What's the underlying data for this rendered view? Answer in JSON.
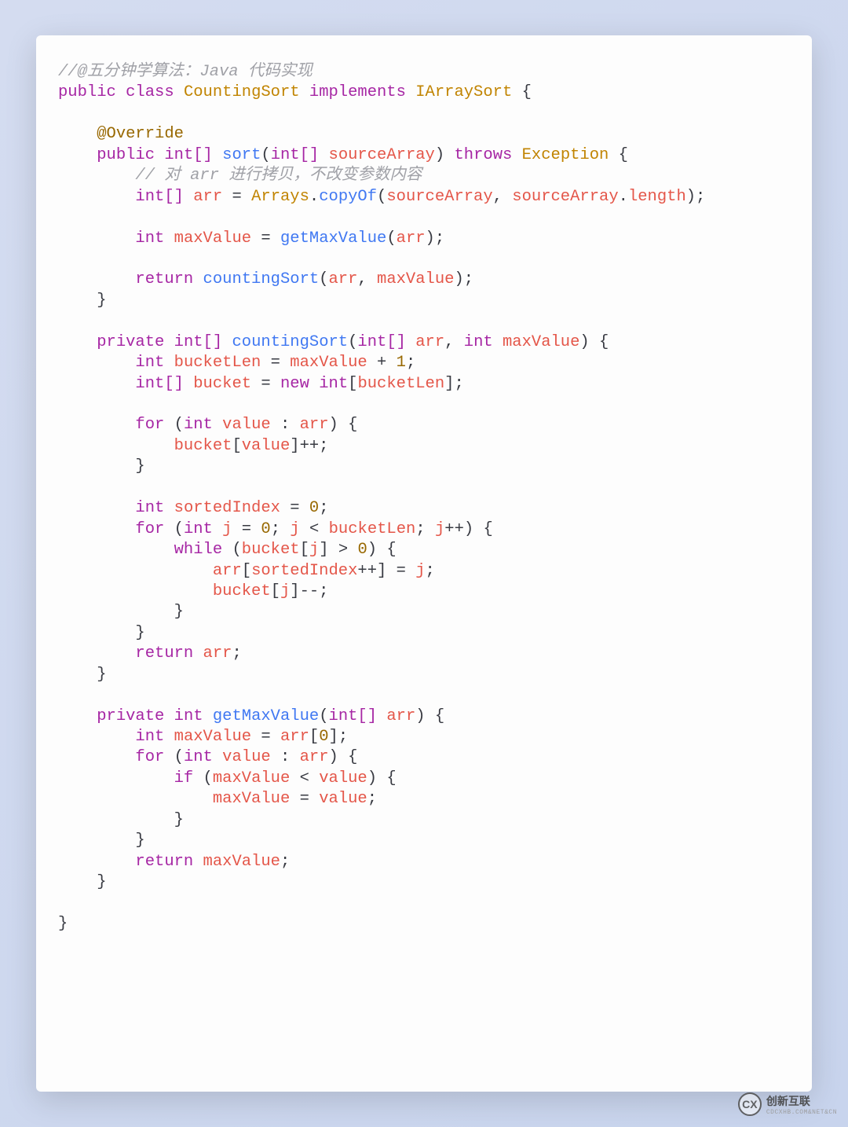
{
  "code": {
    "comment_header": "//@五分钟学算法：Java 代码实现",
    "kw_public": "public",
    "kw_class": "class",
    "cls_CountingSort": "CountingSort",
    "kw_implements": "implements",
    "cls_IArraySort": "IArraySort",
    "annot_Override": "@Override",
    "ty_int_arr": "int[]",
    "ty_int": "int",
    "m_sort": "sort",
    "v_sourceArray": "sourceArray",
    "kw_throws": "throws",
    "cls_Exception": "Exception",
    "comment_copy": "// 对 arr 进行拷贝，不改变参数内容",
    "v_arr": "arr",
    "cls_Arrays": "Arrays",
    "m_copyOf": "copyOf",
    "v_length": "length",
    "v_maxValue": "maxValue",
    "m_getMaxValue": "getMaxValue",
    "kw_return": "return",
    "m_countingSort": "countingSort",
    "kw_private": "private",
    "v_bucketLen": "bucketLen",
    "num_1": "1",
    "v_bucket": "bucket",
    "kw_new": "new",
    "kw_for": "for",
    "v_value": "value",
    "v_sortedIndex": "sortedIndex",
    "num_0": "0",
    "v_j": "j",
    "kw_while": "while",
    "kw_if": "if"
  },
  "watermark": {
    "logo_text": "CX",
    "brand": "创新互联",
    "sub": "CDCXHB.COM&NET&CN"
  }
}
